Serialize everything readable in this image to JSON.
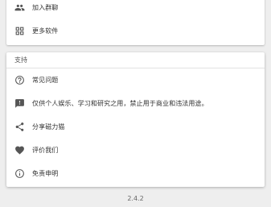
{
  "top_card": {
    "items": [
      {
        "label": "加入群聊",
        "icon": "group-icon"
      },
      {
        "label": "更多软件",
        "icon": "apps-grid-icon"
      }
    ]
  },
  "support_card": {
    "header": "支持",
    "items": [
      {
        "label": "常见问题",
        "icon": "help-circle-icon"
      },
      {
        "label": "仅供个人娱乐、学习和研究之用，禁止用于商业和违法用途。",
        "icon": "feedback-icon"
      },
      {
        "label": "分享磁力猫",
        "icon": "share-icon"
      },
      {
        "label": "评价我们",
        "icon": "heart-icon"
      },
      {
        "label": "免责申明",
        "icon": "info-circle-icon"
      }
    ]
  },
  "footer": {
    "version": "2.4.2"
  }
}
